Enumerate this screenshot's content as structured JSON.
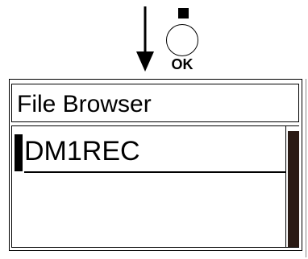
{
  "instruction": {
    "arrow_icon": "down-arrow-icon",
    "stop_icon": "stop-square-icon",
    "ok_button_label": "OK"
  },
  "screen": {
    "title": "File Browser",
    "items": [
      {
        "label": "DM1REC",
        "selected": true
      }
    ],
    "scroll_position": 0.0,
    "colors": {
      "scroll_thumb": "#2a1a14",
      "text": "#000000",
      "background": "#ffffff"
    }
  }
}
